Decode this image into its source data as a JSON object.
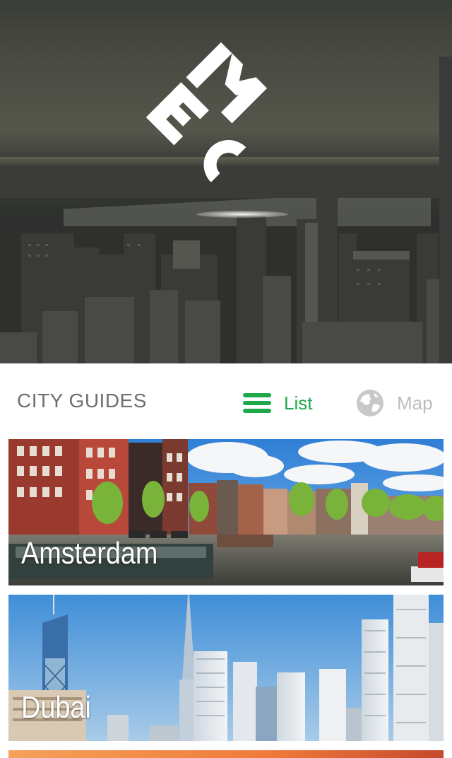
{
  "hero": {
    "logo_name": "mec-logo"
  },
  "toolbar": {
    "section_title": "CITY GUIDES",
    "list_label": "List",
    "map_label": "Map",
    "list_icon": "hamburger-list-icon",
    "map_icon": "globe-icon",
    "active_color": "#1fa84b",
    "inactive_color": "#bdbdbd"
  },
  "cities": [
    {
      "name": "Amsterdam"
    },
    {
      "name": "Dubai"
    }
  ]
}
